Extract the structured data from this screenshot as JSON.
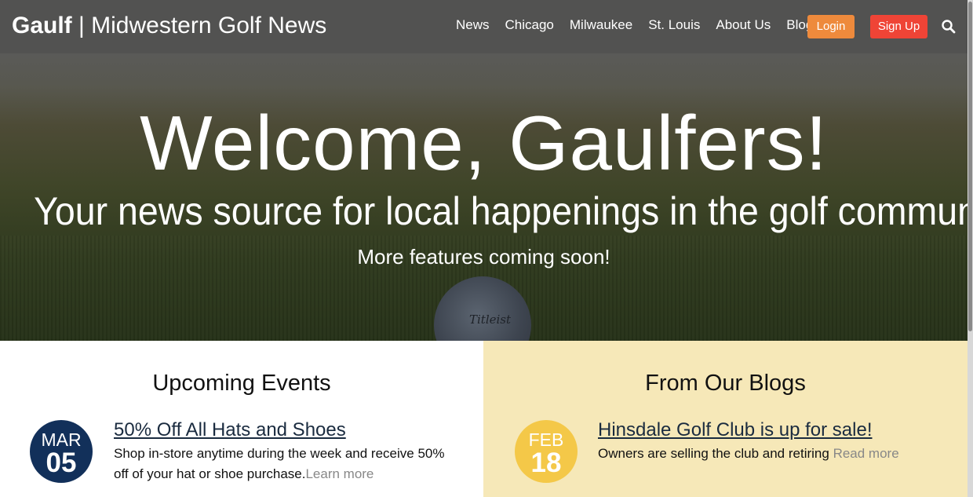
{
  "nav": {
    "brand_bold": "Gaulf",
    "brand_separator": "|",
    "brand_light": "Midwestern Golf News",
    "links": [
      {
        "label": "News"
      },
      {
        "label": "Chicago"
      },
      {
        "label": "Milwaukee"
      },
      {
        "label": "St. Louis"
      },
      {
        "label": "About Us"
      },
      {
        "label": "Blog"
      }
    ],
    "login_label": "Login",
    "signup_label": "Sign Up",
    "search_icon": "search-icon",
    "colors": {
      "login": "#ee8a3c",
      "signup": "#ef4436"
    }
  },
  "hero": {
    "title": "Welcome, Gaulfers!",
    "subtitle": "Your news source for local happenings in the golf community.",
    "note": "More features coming soon!",
    "ball_brand": "Titleist"
  },
  "events": {
    "heading": "Upcoming Events",
    "items": [
      {
        "month": "MAR",
        "day": "05",
        "title": "50% Off All Hats and Shoes",
        "description": "Shop in-store anytime during the week and receive 50% off of your hat or shoe purchase.",
        "link_label": "Learn more"
      }
    ],
    "badge_color": "#12305a"
  },
  "blogs": {
    "heading": "From Our Blogs",
    "items": [
      {
        "month": "FEB",
        "day": "18",
        "title": "Hinsdale Golf Club is up for sale!",
        "description": "Owners are selling the club and retiring",
        "link_label": "Read more"
      }
    ],
    "badge_color": "#f4c848",
    "background": "#f6e8b8"
  }
}
